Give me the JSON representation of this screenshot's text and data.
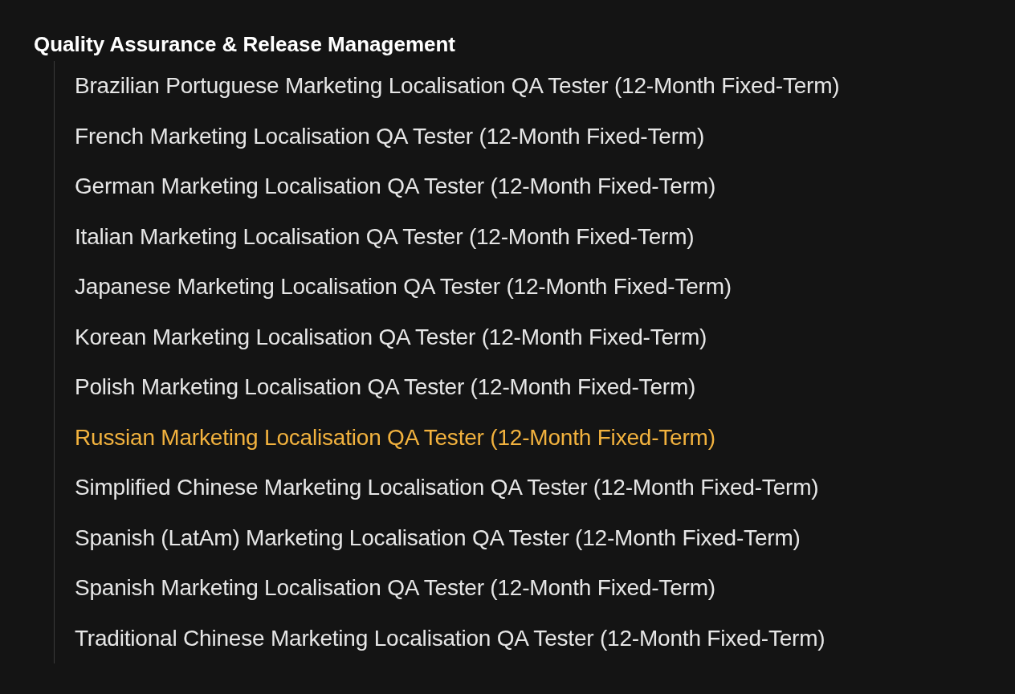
{
  "section": {
    "title": "Quality Assurance & Release Management",
    "items": [
      {
        "label": "Brazilian Portuguese Marketing Localisation QA Tester (12-Month Fixed-Term)",
        "selected": false
      },
      {
        "label": "French Marketing Localisation QA Tester (12-Month Fixed-Term)",
        "selected": false
      },
      {
        "label": "German Marketing Localisation QA Tester (12-Month Fixed-Term)",
        "selected": false
      },
      {
        "label": "Italian Marketing Localisation QA Tester (12-Month Fixed-Term)",
        "selected": false
      },
      {
        "label": "Japanese Marketing Localisation QA Tester (12-Month Fixed-Term)",
        "selected": false
      },
      {
        "label": "Korean Marketing Localisation QA Tester (12-Month Fixed-Term)",
        "selected": false
      },
      {
        "label": "Polish Marketing Localisation QA Tester (12-Month Fixed-Term)",
        "selected": false
      },
      {
        "label": "Russian Marketing Localisation QA Tester (12-Month Fixed-Term)",
        "selected": true
      },
      {
        "label": "Simplified Chinese Marketing Localisation QA Tester (12-Month Fixed-Term)",
        "selected": false
      },
      {
        "label": "Spanish (LatAm) Marketing Localisation QA Tester (12-Month Fixed-Term)",
        "selected": false
      },
      {
        "label": "Spanish Marketing Localisation QA Tester (12-Month Fixed-Term)",
        "selected": false
      },
      {
        "label": "Traditional Chinese Marketing Localisation QA Tester (12-Month Fixed-Term)",
        "selected": false
      }
    ]
  }
}
